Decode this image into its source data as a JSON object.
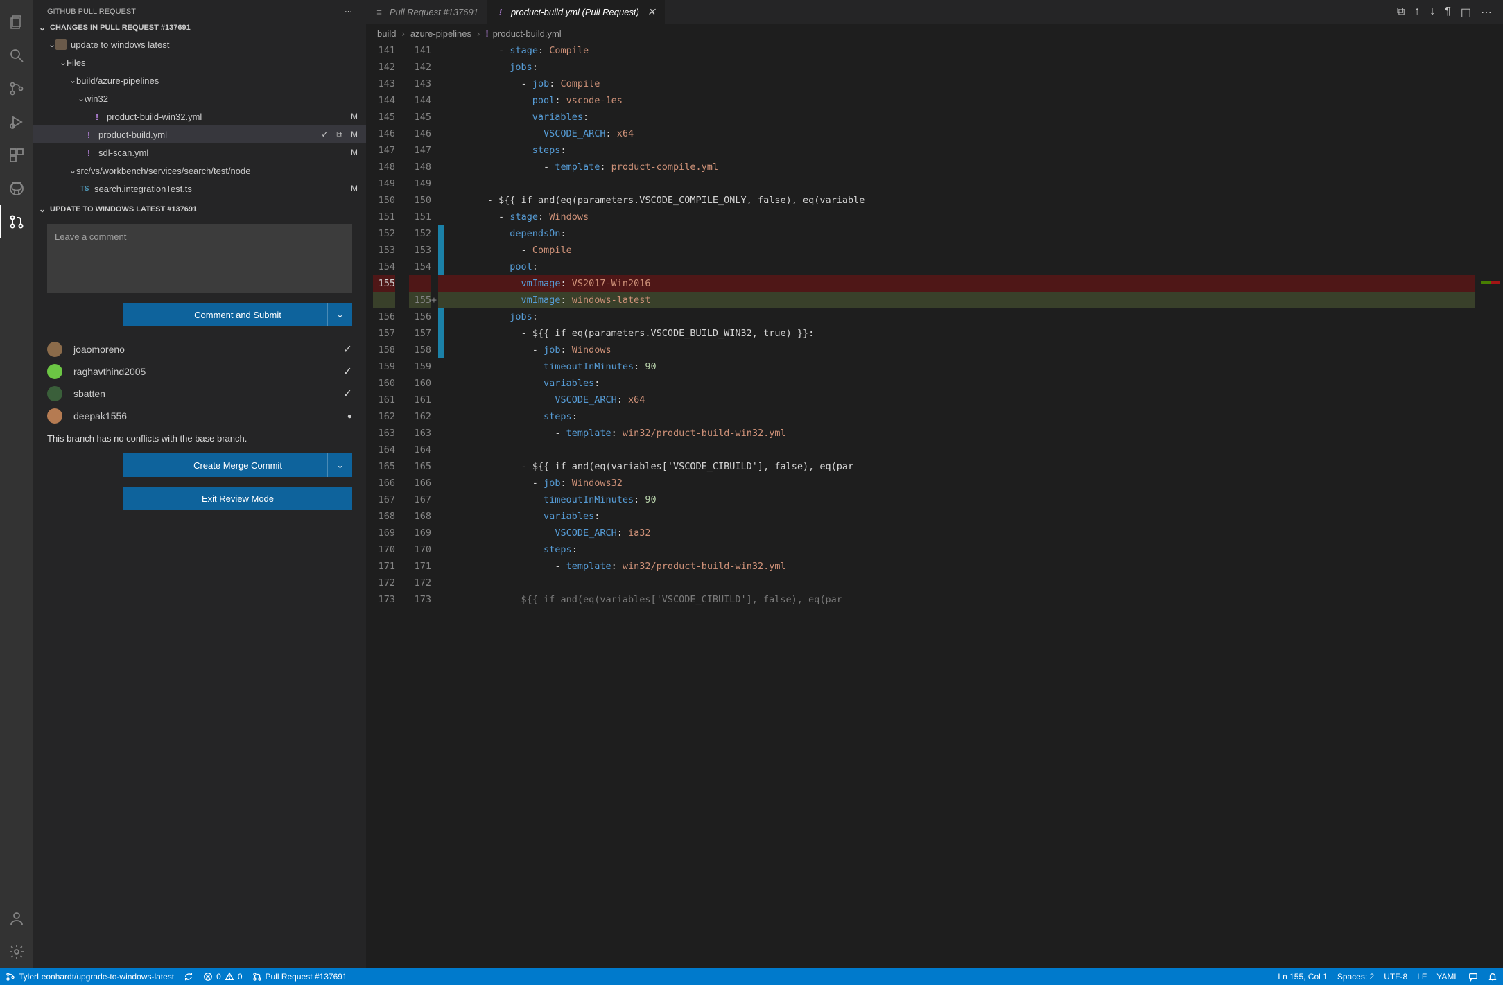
{
  "sidebar": {
    "title": "GITHUB PULL REQUEST",
    "changes_header": "CHANGES IN PULL REQUEST #137691",
    "commit_label": "update to windows latest",
    "files_label": "Files",
    "folder1": "build/azure-pipelines",
    "folder2": "win32",
    "win32_file": "product-build-win32.yml",
    "root_file": "product-build.yml",
    "sdl_file": "sdl-scan.yml",
    "folder3": "src/vs/workbench/services/search/test/node",
    "ts_file": "search.integrationTest.ts",
    "badge_M": "M",
    "review_header": "UPDATE TO WINDOWS LATEST #137691",
    "comment_placeholder": "Leave a comment",
    "comment_submit": "Comment and Submit",
    "reviewers": [
      {
        "name": "joaomoreno",
        "status": "check",
        "color": "#8b6b4a"
      },
      {
        "name": "raghavthind2005",
        "status": "check",
        "color": "#6cc644"
      },
      {
        "name": "sbatten",
        "status": "check",
        "color": "#3a5f3a"
      },
      {
        "name": "deepak1556",
        "status": "dot",
        "color": "#b57b52"
      }
    ],
    "conflict_msg": "This branch has no conflicts with the base branch.",
    "merge_btn": "Create Merge Commit",
    "exit_btn": "Exit Review Mode"
  },
  "tabs": {
    "0": {
      "icon": "≡",
      "label": "Pull Request #137691"
    },
    "1": {
      "icon": "!",
      "label": "product-build.yml (Pull Request)"
    }
  },
  "breadcrumbs": {
    "0": "build",
    "1": "azure-pipelines",
    "2": "product-build.yml"
  },
  "code": {
    "lines": [
      {
        "l": "141",
        "r": "141",
        "html": "        <span class='tk-dash'>-</span> <span class='tk-key'>stage</span><span class='tk-punct'>:</span> <span class='tk-str'>Compile</span>"
      },
      {
        "l": "142",
        "r": "142",
        "html": "          <span class='tk-key'>jobs</span><span class='tk-punct'>:</span>"
      },
      {
        "l": "143",
        "r": "143",
        "html": "            <span class='tk-dash'>-</span> <span class='tk-key'>job</span><span class='tk-punct'>:</span> <span class='tk-str'>Compile</span>"
      },
      {
        "l": "144",
        "r": "144",
        "html": "              <span class='tk-key'>pool</span><span class='tk-punct'>:</span> <span class='tk-str'>vscode-1es</span>"
      },
      {
        "l": "145",
        "r": "145",
        "html": "              <span class='tk-key'>variables</span><span class='tk-punct'>:</span>"
      },
      {
        "l": "146",
        "r": "146",
        "html": "                <span class='tk-key'>VSCODE_ARCH</span><span class='tk-punct'>:</span> <span class='tk-str'>x64</span>"
      },
      {
        "l": "147",
        "r": "147",
        "html": "              <span class='tk-key'>steps</span><span class='tk-punct'>:</span>"
      },
      {
        "l": "148",
        "r": "148",
        "html": "                <span class='tk-dash'>-</span> <span class='tk-key'>template</span><span class='tk-punct'>:</span> <span class='tk-str'>product-compile.yml</span>"
      },
      {
        "l": "149",
        "r": "149",
        "html": ""
      },
      {
        "l": "150",
        "r": "150",
        "html": "      <span class='tk-dash'>-</span> <span class='tk-cond'>${{ if and(eq(parameters.VSCODE_COMPILE_ONLY, false), eq(variable</span>"
      },
      {
        "l": "151",
        "r": "151",
        "html": "        <span class='tk-dash'>-</span> <span class='tk-key'>stage</span><span class='tk-punct'>:</span> <span class='tk-str'>Windows</span>"
      },
      {
        "l": "152",
        "r": "152",
        "html": "          <span class='tk-key'>dependsOn</span><span class='tk-punct'>:</span>",
        "glyph": "mod"
      },
      {
        "l": "153",
        "r": "153",
        "html": "            <span class='tk-dash'>-</span> <span class='tk-str'>Compile</span>",
        "glyph": "mod"
      },
      {
        "l": "154",
        "r": "154",
        "html": "          <span class='tk-key'>pool</span><span class='tk-punct'>:</span>",
        "glyph": "mod"
      },
      {
        "l": "155",
        "r": "",
        "html": "            <span class='tk-key'>vmImage</span><span class='tk-punct'>:</span> <span class='tk-str'>VS2017-Win2016</span>",
        "kind": "del",
        "glyph": "mod"
      },
      {
        "l": "",
        "r": "155",
        "html": "            <span class='tk-key'>vmImage</span><span class='tk-punct'>:</span> <span class='tk-str'>windows-latest</span>",
        "kind": "add",
        "glyph": "mod",
        "plus": true
      },
      {
        "l": "156",
        "r": "156",
        "html": "          <span class='tk-key'>jobs</span><span class='tk-punct'>:</span>",
        "glyph": "mod"
      },
      {
        "l": "157",
        "r": "157",
        "html": "            <span class='tk-dash'>-</span> <span class='tk-cond'>${{ if eq(parameters.VSCODE_BUILD_WIN32, true) }}</span><span class='tk-punct'>:</span>",
        "glyph": "mod"
      },
      {
        "l": "158",
        "r": "158",
        "html": "              <span class='tk-dash'>-</span> <span class='tk-key'>job</span><span class='tk-punct'>:</span> <span class='tk-str'>Windows</span>",
        "glyph": "mod"
      },
      {
        "l": "159",
        "r": "159",
        "html": "                <span class='tk-key'>timeoutInMinutes</span><span class='tk-punct'>:</span> <span class='tk-num'>90</span>"
      },
      {
        "l": "160",
        "r": "160",
        "html": "                <span class='tk-key'>variables</span><span class='tk-punct'>:</span>"
      },
      {
        "l": "161",
        "r": "161",
        "html": "                  <span class='tk-key'>VSCODE_ARCH</span><span class='tk-punct'>:</span> <span class='tk-str'>x64</span>"
      },
      {
        "l": "162",
        "r": "162",
        "html": "                <span class='tk-key'>steps</span><span class='tk-punct'>:</span>"
      },
      {
        "l": "163",
        "r": "163",
        "html": "                  <span class='tk-dash'>-</span> <span class='tk-key'>template</span><span class='tk-punct'>:</span> <span class='tk-str'>win32/product-build-win32.yml</span>"
      },
      {
        "l": "164",
        "r": "164",
        "html": ""
      },
      {
        "l": "165",
        "r": "165",
        "html": "            <span class='tk-dash'>-</span> <span class='tk-cond'>${{ if and(eq(variables['VSCODE_CIBUILD'], false), eq(par</span>"
      },
      {
        "l": "166",
        "r": "166",
        "html": "              <span class='tk-dash'>-</span> <span class='tk-key'>job</span><span class='tk-punct'>:</span> <span class='tk-str'>Windows32</span>"
      },
      {
        "l": "167",
        "r": "167",
        "html": "                <span class='tk-key'>timeoutInMinutes</span><span class='tk-punct'>:</span> <span class='tk-num'>90</span>"
      },
      {
        "l": "168",
        "r": "168",
        "html": "                <span class='tk-key'>variables</span><span class='tk-punct'>:</span>"
      },
      {
        "l": "169",
        "r": "169",
        "html": "                  <span class='tk-key'>VSCODE_ARCH</span><span class='tk-punct'>:</span> <span class='tk-str'>ia32</span>"
      },
      {
        "l": "170",
        "r": "170",
        "html": "                <span class='tk-key'>steps</span><span class='tk-punct'>:</span>"
      },
      {
        "l": "171",
        "r": "171",
        "html": "                  <span class='tk-dash'>-</span> <span class='tk-key'>template</span><span class='tk-punct'>:</span> <span class='tk-str'>win32/product-build-win32.yml</span>"
      },
      {
        "l": "172",
        "r": "172",
        "html": ""
      },
      {
        "l": "173",
        "r": "173",
        "html": "            <span class='tk-cond' style='opacity:.5'>${{ if and(eq(variables['VSCODE_CIBUILD'], false), eq(par</span>"
      }
    ]
  },
  "statusbar": {
    "branch": "TylerLeonhardt/upgrade-to-windows-latest",
    "errors": "0",
    "warnings": "0",
    "pr": "Pull Request #137691",
    "ln_col": "Ln 155, Col 1",
    "spaces": "Spaces: 2",
    "encoding": "UTF-8",
    "eol": "LF",
    "lang": "YAML"
  }
}
